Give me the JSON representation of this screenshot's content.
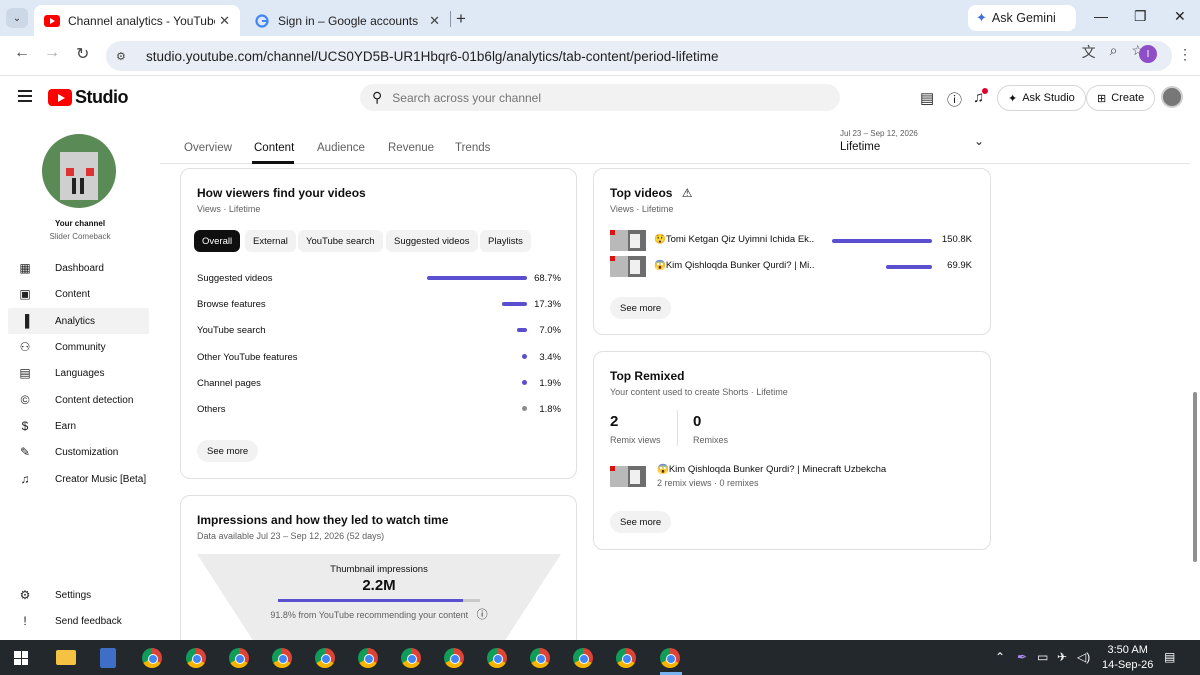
{
  "browser": {
    "tabs": [
      {
        "title": "Channel analytics - YouTube Stu",
        "active": true,
        "close": "✕"
      },
      {
        "title": "Sign in – Google accounts",
        "active": false,
        "close": "✕"
      }
    ],
    "new_tab": "+",
    "gemini": "Ask Gemini",
    "url": "studio.youtube.com/channel/UCS0YD5B-UR1Hbqr6-01b6lg/analytics/tab-content/period-lifetime",
    "profile_initial": "I",
    "window_controls": [
      "—",
      "❐",
      "✕"
    ]
  },
  "studio": {
    "logo_text": "Studio",
    "search_placeholder": "Search across your channel",
    "ask_studio": "Ask Studio",
    "create": "Create"
  },
  "sidebar": {
    "your_channel": "Your channel",
    "channel_name": "Slider Comeback",
    "items": [
      {
        "label": "Dashboard",
        "icon": "dashboard-icon",
        "glyph": "▦"
      },
      {
        "label": "Content",
        "icon": "content-icon",
        "glyph": "▣"
      },
      {
        "label": "Analytics",
        "icon": "analytics-icon",
        "glyph": "▐"
      },
      {
        "label": "Community",
        "icon": "community-icon",
        "glyph": "⚇"
      },
      {
        "label": "Languages",
        "icon": "languages-icon",
        "glyph": "▤"
      },
      {
        "label": "Content detection",
        "icon": "content-detection-icon",
        "glyph": "©"
      },
      {
        "label": "Earn",
        "icon": "earn-icon",
        "glyph": "$"
      },
      {
        "label": "Customization",
        "icon": "customization-icon",
        "glyph": "✎"
      },
      {
        "label": "Creator Music [Beta]",
        "icon": "creator-music-icon",
        "glyph": "♫"
      }
    ],
    "bottom_items": [
      {
        "label": "Settings",
        "icon": "settings-icon",
        "glyph": "⚙"
      },
      {
        "label": "Send feedback",
        "icon": "feedback-icon",
        "glyph": "!"
      }
    ]
  },
  "analytics": {
    "tabs": [
      "Overview",
      "Content",
      "Audience",
      "Revenue",
      "Trends"
    ],
    "active_tab": "Content",
    "period_range": "Jul 23 – Sep 12, 2026",
    "period_label": "Lifetime"
  },
  "traffic_card": {
    "title": "How viewers find your videos",
    "subtitle": "Views · Lifetime",
    "chips": [
      "Overall",
      "External",
      "YouTube search",
      "Suggested videos",
      "Playlists"
    ],
    "active_chip": "Overall",
    "sources": [
      {
        "label": "Suggested videos",
        "pct": "68.7%",
        "share": 0.687
      },
      {
        "label": "Browse features",
        "pct": "17.3%",
        "share": 0.173
      },
      {
        "label": "YouTube search",
        "pct": "7.0%",
        "share": 0.07
      },
      {
        "label": "Other YouTube features",
        "pct": "3.4%",
        "share": 0.034
      },
      {
        "label": "Channel pages",
        "pct": "1.9%",
        "share": 0.019
      },
      {
        "label": "Others",
        "pct": "1.8%",
        "share": 0.018
      }
    ],
    "see_more": "See more"
  },
  "impressions_card": {
    "title": "Impressions and how they led to watch time",
    "subtitle": "Data available Jul 23 – Sep 12, 2026 (52 days)",
    "thumb_label": "Thumbnail impressions",
    "thumb_value": "2.2M",
    "recommend_text": "91.8% from YouTube recommending your content",
    "recommend_share": 0.918
  },
  "top_videos": {
    "title": "Top videos",
    "warning_icon": "⚠",
    "subtitle": "Views · Lifetime",
    "videos": [
      {
        "title": "😲Tomi Ketgan Qiz Uyimni Ichida Ek...",
        "views": "150.8K",
        "share": 1.0
      },
      {
        "title": "😱Kim Qishloqda Bunker Qurdi? | Mi...",
        "views": "69.9K",
        "share": 0.46
      }
    ],
    "see_more": "See more"
  },
  "top_remixed": {
    "title": "Top Remixed",
    "subtitle": "Your content used to create Shorts · Lifetime",
    "remix_views_value": "2",
    "remix_views_label": "Remix views",
    "remixes_value": "0",
    "remixes_label": "Remixes",
    "video_title": "😱Kim Qishloqda Bunker Qurdi? | Minecraft Uzbekcha",
    "video_meta": "2 remix views · 0 remixes",
    "see_more": "See more"
  },
  "taskbar": {
    "time": "3:50 AM",
    "date": "14-Sep-26"
  }
}
